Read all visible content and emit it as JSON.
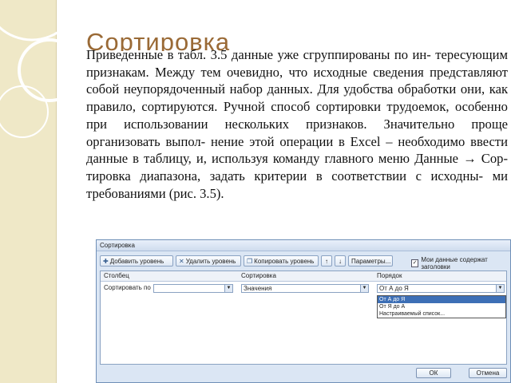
{
  "slide": {
    "title": "Сортировка",
    "paragraph_lines": [
      "Приведенные в табл. 3.5 данные уже сгруппированы по ин-",
      "тересующим признакам. Между тем очевидно, что исходные",
      "сведения представляют собой неупорядоченный набор данных.",
      "Для удобства обработки они, как правило, сортируются. Ручной",
      "способ сортировки трудоемок, особенно при использовании",
      "нескольких признаков. Значительно проще организовать выпол-",
      "нение этой операции в Excel – необходимо ввести данные в",
      "таблицу, и, используя команду главного меню Данные → Сор-",
      "тировка диапазона, задать критерии в соответствии с исходны-",
      "ми требованиями (рис. 3.5)."
    ]
  },
  "dialog": {
    "title": "Сортировка",
    "toolbar": {
      "add_level": "Добавить уровень",
      "delete_level": "Удалить уровень",
      "copy_level": "Копировать уровень",
      "up_arrow": "↑",
      "down_arrow": "↓",
      "parameters": "Параметры...",
      "headers_checkbox_label": "Мои данные содержат заголовки"
    },
    "columns": {
      "column_header": "Столбец",
      "sort_header": "Сортировка",
      "order_header": "Порядок"
    },
    "row": {
      "sort_by_label": "Сортировать по",
      "column_value": "",
      "sort_on_value": "Значения",
      "order_value": "От А до Я"
    },
    "order_options": [
      "От А до Я",
      "От Я до А",
      "Настраиваемый список..."
    ],
    "ok_label": "ОК",
    "cancel_label": "Отмена"
  }
}
